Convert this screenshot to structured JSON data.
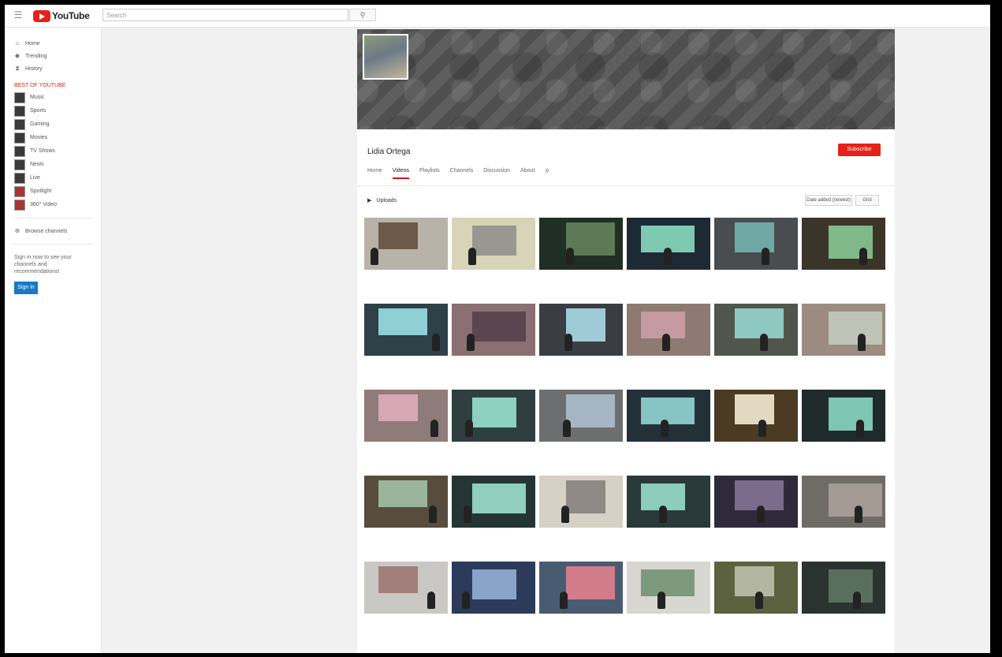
{
  "masthead": {
    "logo_text": "YouTube",
    "search_placeholder": "Search"
  },
  "guide": {
    "nav": [
      {
        "label": "Home",
        "icon": "home-icon"
      },
      {
        "label": "Trending",
        "icon": "trending-icon"
      },
      {
        "label": "History",
        "icon": "history-icon"
      }
    ],
    "subscriptions_heading": "BEST OF YOUTUBE",
    "subscriptions": [
      {
        "label": "Music"
      },
      {
        "label": "Sports"
      },
      {
        "label": "Gaming"
      },
      {
        "label": "Movies"
      },
      {
        "label": "TV Shows"
      },
      {
        "label": "News"
      },
      {
        "label": "Live"
      },
      {
        "label": "Spotlight"
      },
      {
        "label": "360° Video"
      }
    ],
    "browse_channels": "Browse channels",
    "signin_text": "Sign in now to see your channels and recommendations!",
    "signin_button": "Sign in"
  },
  "channel": {
    "title": "Lidia Ortega",
    "subscribe_label": "Subscribe",
    "tabs": [
      "Home",
      "Videos",
      "Playlists",
      "Channels",
      "Discussion",
      "About"
    ],
    "active_tab": 1,
    "uploads_label": "Uploads",
    "sort_label": "Date added (newest)",
    "grid_label": "Grid"
  },
  "videos": [
    {
      "title": "",
      "meta": "",
      "duration": ""
    },
    {
      "title": "",
      "meta": "",
      "duration": ""
    },
    {
      "title": "",
      "meta": "",
      "duration": ""
    },
    {
      "title": "",
      "meta": "",
      "duration": ""
    },
    {
      "title": "",
      "meta": "",
      "duration": ""
    },
    {
      "title": "",
      "meta": "",
      "duration": ""
    },
    {
      "title": "",
      "meta": "",
      "duration": ""
    },
    {
      "title": "",
      "meta": "",
      "duration": ""
    },
    {
      "title": "",
      "meta": "",
      "duration": ""
    },
    {
      "title": "",
      "meta": "",
      "duration": ""
    },
    {
      "title": "",
      "meta": "",
      "duration": ""
    },
    {
      "title": "",
      "meta": "",
      "duration": ""
    },
    {
      "title": "",
      "meta": "",
      "duration": ""
    },
    {
      "title": "",
      "meta": "",
      "duration": ""
    },
    {
      "title": "",
      "meta": "",
      "duration": ""
    },
    {
      "title": "",
      "meta": "",
      "duration": ""
    },
    {
      "title": "",
      "meta": "",
      "duration": ""
    },
    {
      "title": "",
      "meta": "",
      "duration": ""
    },
    {
      "title": "",
      "meta": "",
      "duration": ""
    },
    {
      "title": "",
      "meta": "",
      "duration": ""
    },
    {
      "title": "",
      "meta": "",
      "duration": ""
    },
    {
      "title": "",
      "meta": "",
      "duration": ""
    },
    {
      "title": "",
      "meta": "",
      "duration": ""
    },
    {
      "title": "",
      "meta": "",
      "duration": ""
    },
    {
      "title": "",
      "meta": "",
      "duration": ""
    },
    {
      "title": "",
      "meta": "",
      "duration": ""
    },
    {
      "title": "",
      "meta": "",
      "duration": ""
    },
    {
      "title": "",
      "meta": "",
      "duration": ""
    },
    {
      "title": "",
      "meta": "",
      "duration": ""
    },
    {
      "title": "",
      "meta": "",
      "duration": ""
    }
  ]
}
